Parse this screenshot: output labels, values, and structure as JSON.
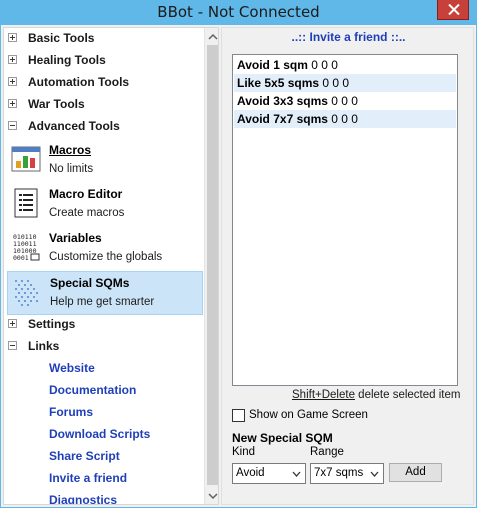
{
  "window": {
    "title": "BBot - Not Connected"
  },
  "sidebar": {
    "sections": [
      {
        "label": "Basic Tools",
        "expanded": false
      },
      {
        "label": "Healing Tools",
        "expanded": false
      },
      {
        "label": "Automation Tools",
        "expanded": false
      },
      {
        "label": "War Tools",
        "expanded": false
      },
      {
        "label": "Advanced Tools",
        "expanded": true
      },
      {
        "label": "Settings",
        "expanded": false
      },
      {
        "label": "Links",
        "expanded": true
      }
    ],
    "advanced_items": [
      {
        "name": "Macros",
        "desc": "No limits",
        "icon": "macros-chart-icon"
      },
      {
        "name": "Macro Editor",
        "desc": "Create macros",
        "icon": "macro-editor-document-icon"
      },
      {
        "name": "Variables",
        "desc": "Customize the globals",
        "icon": "variables-binary-icon"
      },
      {
        "name": "Special SQMs",
        "desc": "Help me get smarter",
        "icon": "special-sqms-dots-icon",
        "selected": true
      }
    ],
    "links": [
      "Website",
      "Documentation",
      "Forums",
      "Download Scripts",
      "Share Script",
      "Invite a friend",
      "Diagnostics"
    ]
  },
  "panel": {
    "header": "..:: Invite a friend ::..",
    "list": [
      {
        "label": "Avoid 1 sqm",
        "values": "0 0 0"
      },
      {
        "label": "Like 5x5 sqms",
        "values": "0 0 0"
      },
      {
        "label": "Avoid 3x3 sqms",
        "values": "0 0 0"
      },
      {
        "label": "Avoid 7x7 sqms",
        "values": "0 0 0"
      }
    ],
    "hint_key": "Shift+Delete",
    "hint_text": " delete selected item",
    "show_on_screen_label": "Show on Game Screen",
    "show_on_screen_checked": false,
    "new_title": "New Special SQM",
    "kind_label": "Kind",
    "range_label": "Range",
    "kind_value": "Avoid",
    "range_value": "7x7 sqms",
    "add_label": "Add"
  }
}
